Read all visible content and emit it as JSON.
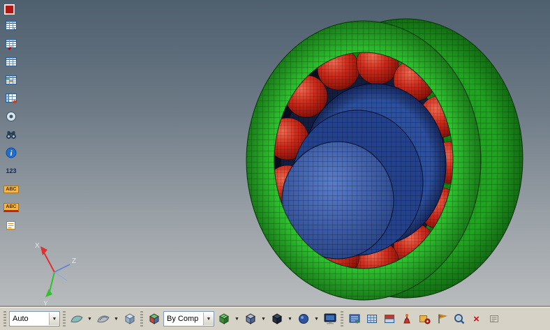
{
  "icons": {
    "chevron_down": "▼",
    "close_x": "×",
    "info_i": "i"
  },
  "left_toolbar": {
    "numbers_label": "123",
    "abc_top_label": "ABC",
    "abc_bottom_label": "ABC"
  },
  "bottom_toolbar": {
    "view_mode_value": "Auto",
    "color_mode_value": "By Comp"
  },
  "viewport": {
    "triad": {
      "x_label": "X",
      "y_label": "Y",
      "z_label": "Z"
    },
    "model_colors": {
      "outer_ring_green": "#2bc32b",
      "rollers_red": "#cc2a1a",
      "inner_ring_blue": "#2c4f9e",
      "background_top": "#4e5f6e",
      "background_bottom": "#b9bcbe"
    }
  }
}
